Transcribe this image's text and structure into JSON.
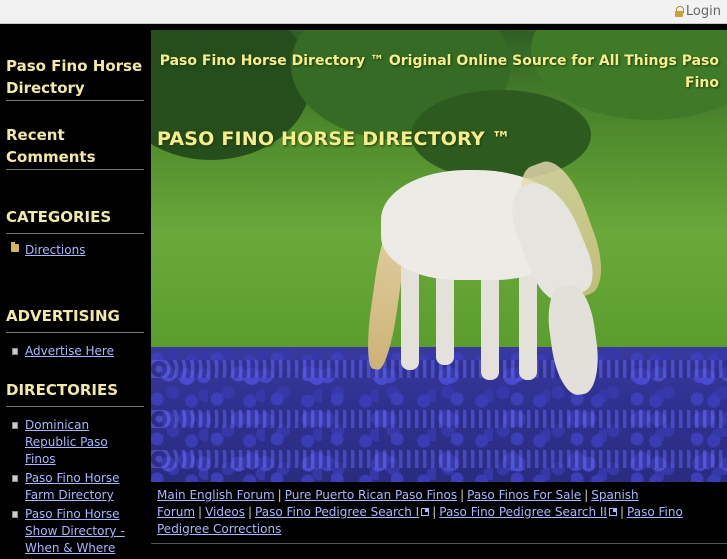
{
  "topbar": {
    "login_label": "Login"
  },
  "sidebar": {
    "site_title": "Paso Fino Horse Directory",
    "recent_comments": "Recent Comments",
    "categories": {
      "heading": "CATEGORIES",
      "items": [
        "",
        "Directions"
      ]
    },
    "advertising": {
      "heading": "ADVERTISING",
      "items": [
        "Advertise Here"
      ]
    },
    "directories": {
      "heading": "DIRECTORIES",
      "items": [
        "Dominican Republic Paso Finos",
        "Paso Fino Horse Farm Directory",
        "Paso Fino Horse Show Directory - When & Where"
      ]
    }
  },
  "hero": {
    "tagline": "Paso Fino Horse Directory ™ Original Online Source for All Things Paso Fino",
    "title": "PASO FINO HORSE DIRECTORY ™"
  },
  "footer_nav": {
    "links": [
      "Main English Forum",
      "Pure Puerto Rican Paso Finos",
      "Paso Finos For Sale",
      "Spanish Forum",
      "Videos",
      "Paso Fino Pedigree Search I",
      "Paso Fino Pedigree Search II",
      "Paso Fino Pedigree Corrections"
    ],
    "separator": "|"
  },
  "colors": {
    "heading": "#f2e9a6",
    "link": "#aab6ff",
    "hero_text": "#f7ee8a",
    "background": "#000000"
  }
}
